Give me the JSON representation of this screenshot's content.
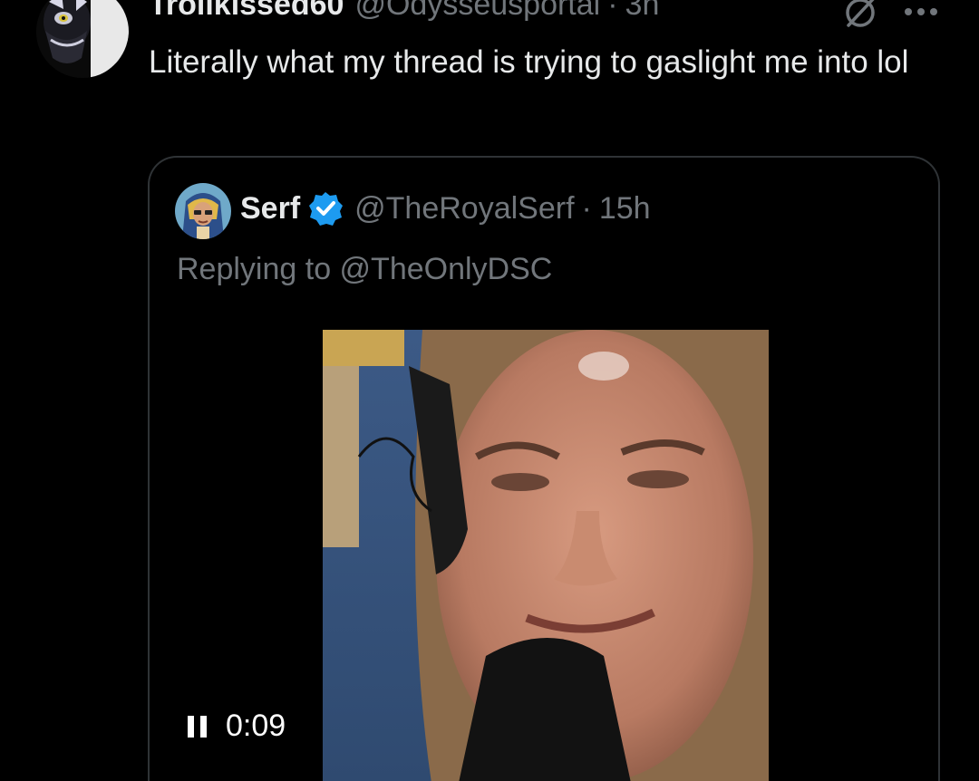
{
  "tweet": {
    "display_name": "Trollkissed60",
    "handle": "@Odysseusportal",
    "separator": "·",
    "time": "3h",
    "text": "Literally what my thread is trying to gaslight me into lol",
    "avatar_icon": "masked-cat-avatar",
    "grok_icon": "grok-slash-icon",
    "more_icon": "more-dots-icon"
  },
  "quote": {
    "display_name": "Serf",
    "verified_icon": "verified-badge-icon",
    "handle": "@TheRoyalSerf",
    "separator": "·",
    "time": "15h",
    "replying_to": "Replying to @TheOnlyDSC",
    "avatar_icon": "pharaoh-avatar"
  },
  "video": {
    "state_icon": "pause-icon",
    "elapsed": "0:09"
  },
  "colors": {
    "background": "#000000",
    "text_primary": "#e7e9ea",
    "text_secondary": "#71767b",
    "border": "#2f3336",
    "verified_blue": "#1d9bf0"
  }
}
